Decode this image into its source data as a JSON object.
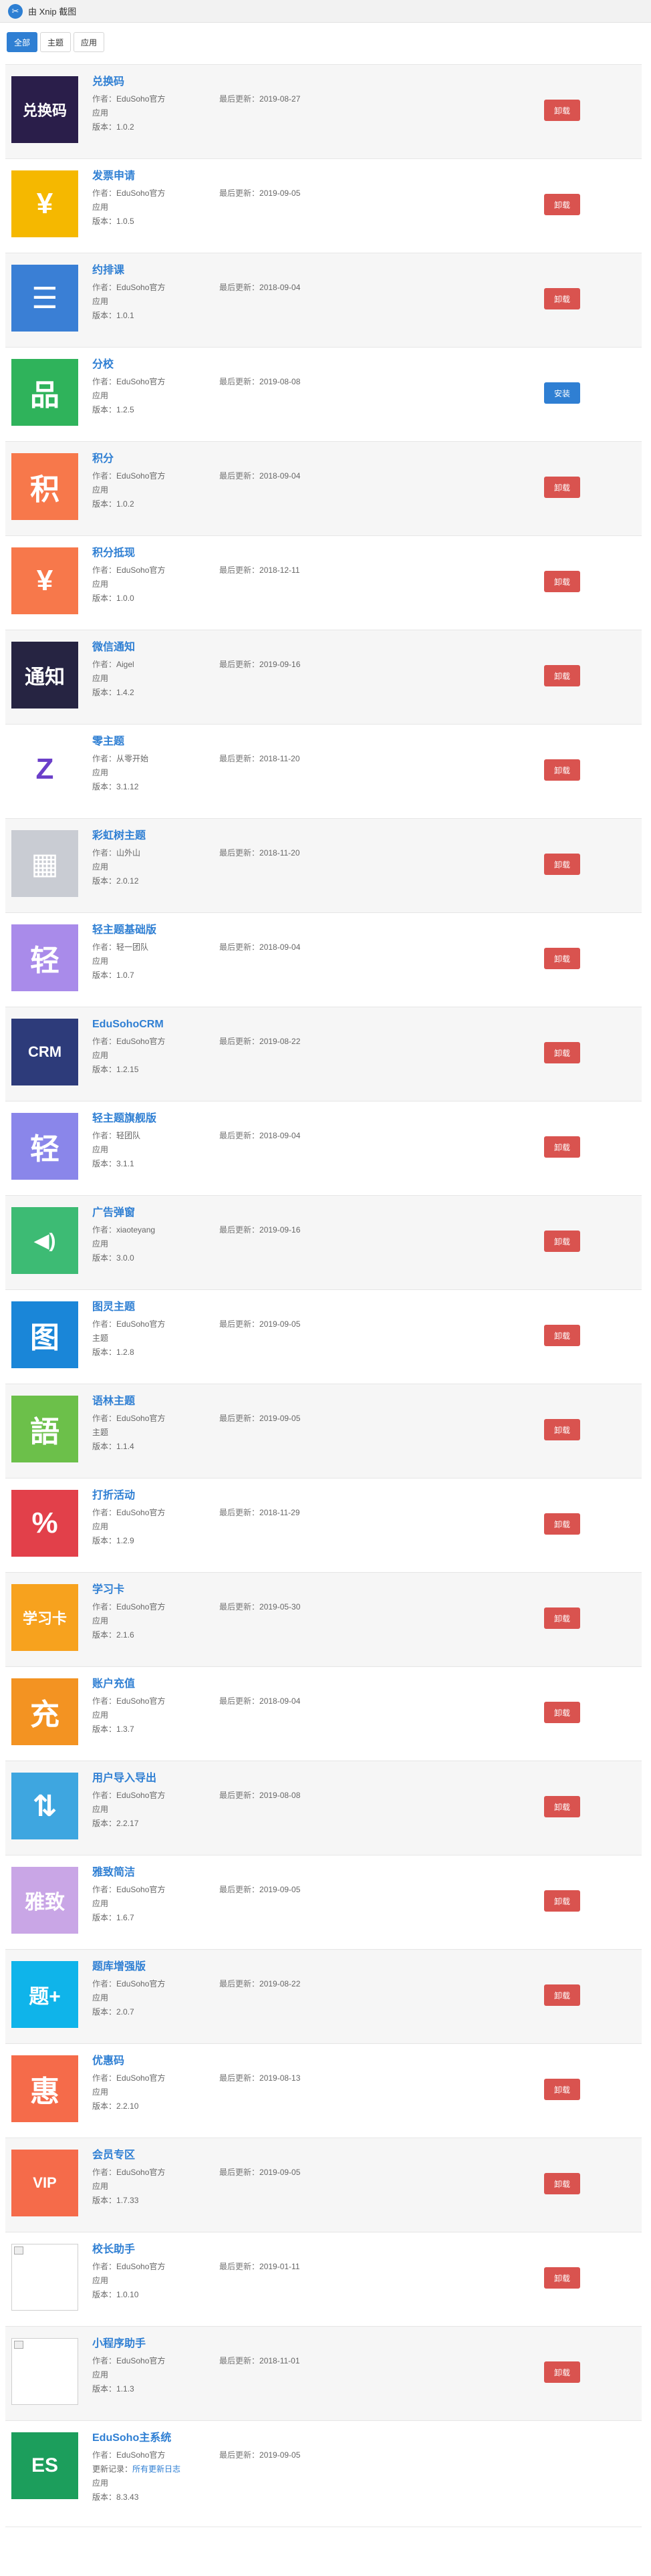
{
  "window": {
    "title": "由 Xnip 截图"
  },
  "tabs": [
    {
      "label": "全部",
      "active": true
    },
    {
      "label": "主题"
    },
    {
      "label": "应用"
    }
  ],
  "labels": {
    "author": "作者：",
    "updated": "最后更新：",
    "version": "版本：",
    "changelog": "更新记录：",
    "changelog_link": "所有更新日志"
  },
  "colors": {
    "accent": "#2f7fd3",
    "uninstall": "#d9534f",
    "install": "#2f7fd3"
  },
  "items": [
    {
      "name": "兑换码",
      "author": "EduSoho官方",
      "updated": "2019-08-27",
      "type": "应用",
      "version": "1.0.2",
      "action": "卸载",
      "icon_text": "兑换码",
      "icon_bg": "#2a1e4a",
      "icon_name": "redeem-code-icon"
    },
    {
      "name": "发票申请",
      "author": "EduSoho官方",
      "updated": "2019-09-05",
      "type": "应用",
      "version": "1.0.5",
      "action": "卸载",
      "icon_text": "¥",
      "icon_bg": "#f5b800",
      "icon_name": "invoice-icon"
    },
    {
      "name": "约排课",
      "author": "EduSoho官方",
      "updated": "2018-09-04",
      "type": "应用",
      "version": "1.0.1",
      "action": "卸载",
      "icon_text": "☰",
      "icon_bg": "#3a7fd5",
      "icon_name": "schedule-icon"
    },
    {
      "name": "分校",
      "author": "EduSoho官方",
      "updated": "2019-08-08",
      "type": "应用",
      "version": "1.2.5",
      "action": "安装",
      "icon_text": "品",
      "icon_bg": "#2fb35b",
      "icon_name": "branch-school-icon"
    },
    {
      "name": "积分",
      "author": "EduSoho官方",
      "updated": "2018-09-04",
      "type": "应用",
      "version": "1.0.2",
      "action": "卸载",
      "icon_text": "积",
      "icon_bg": "#f7784b",
      "icon_name": "points-icon"
    },
    {
      "name": "积分抵现",
      "author": "EduSoho官方",
      "updated": "2018-12-11",
      "type": "应用",
      "version": "1.0.0",
      "action": "卸载",
      "icon_text": "¥",
      "icon_bg": "#f7784b",
      "icon_name": "points-cash-icon"
    },
    {
      "name": "微信通知",
      "author": "Aigel",
      "updated": "2019-09-16",
      "type": "应用",
      "version": "1.4.2",
      "action": "卸载",
      "icon_text": "通知",
      "icon_bg": "#262442",
      "icon_name": "wechat-notify-icon"
    },
    {
      "name": "零主题",
      "author": "从零开始",
      "updated": "2018-11-20",
      "type": "应用",
      "version": "3.1.12",
      "action": "卸载",
      "icon_text": "Z",
      "icon_bg": "#ffffff",
      "icon_name": "zero-theme-icon"
    },
    {
      "name": "彩虹树主题",
      "author": "山外山",
      "updated": "2018-11-20",
      "type": "应用",
      "version": "2.0.12",
      "action": "卸载",
      "icon_text": "▦",
      "icon_bg": "#c9ccd3",
      "icon_name": "rainbow-tree-theme-icon"
    },
    {
      "name": "轻主题基础版",
      "author": "轻一团队",
      "updated": "2018-09-04",
      "type": "应用",
      "version": "1.0.7",
      "action": "卸载",
      "icon_text": "轻",
      "icon_bg": "#a98bea",
      "icon_name": "light-theme-basic-icon"
    },
    {
      "name": "EduSohoCRM",
      "author": "EduSoho官方",
      "updated": "2019-08-22",
      "type": "应用",
      "version": "1.2.15",
      "action": "卸载",
      "icon_text": "CRM",
      "icon_bg": "#2d3b7a",
      "icon_name": "crm-icon"
    },
    {
      "name": "轻主题旗舰版",
      "author": "轻团队",
      "updated": "2018-09-04",
      "type": "应用",
      "version": "3.1.1",
      "action": "卸载",
      "icon_text": "轻",
      "icon_bg": "#8a86ea",
      "icon_name": "light-theme-flagship-icon"
    },
    {
      "name": "广告弹窗",
      "author": "xiaoteyang",
      "updated": "2019-09-16",
      "type": "应用",
      "version": "3.0.0",
      "action": "卸载",
      "icon_text": "◀)",
      "icon_bg": "#3dbb74",
      "icon_name": "ad-popup-icon"
    },
    {
      "name": "图灵主题",
      "author": "EduSoho官方",
      "updated": "2019-09-05",
      "type": "主题",
      "version": "1.2.8",
      "action": "卸载",
      "icon_text": "图",
      "icon_bg": "#1a86d8",
      "icon_name": "turing-theme-icon"
    },
    {
      "name": "语林主题",
      "author": "EduSoho官方",
      "updated": "2019-09-05",
      "type": "主题",
      "version": "1.1.4",
      "action": "卸载",
      "icon_text": "語",
      "icon_bg": "#6cc04a",
      "icon_name": "yulin-theme-icon"
    },
    {
      "name": "打折活动",
      "author": "EduSoho官方",
      "updated": "2018-11-29",
      "type": "应用",
      "version": "1.2.9",
      "action": "卸载",
      "icon_text": "%",
      "icon_bg": "#e2404a",
      "icon_name": "discount-icon"
    },
    {
      "name": "学习卡",
      "author": "EduSoho官方",
      "updated": "2019-05-30",
      "type": "应用",
      "version": "2.1.6",
      "action": "卸载",
      "icon_text": "学习卡",
      "icon_bg": "#f7a21e",
      "icon_name": "study-card-icon"
    },
    {
      "name": "账户充值",
      "author": "EduSoho官方",
      "updated": "2018-09-04",
      "type": "应用",
      "version": "1.3.7",
      "action": "卸载",
      "icon_text": "充",
      "icon_bg": "#f39322",
      "icon_name": "recharge-icon"
    },
    {
      "name": "用户导入导出",
      "author": "EduSoho官方",
      "updated": "2019-08-08",
      "type": "应用",
      "version": "2.2.17",
      "action": "卸载",
      "icon_text": "⇅",
      "icon_bg": "#3ea6e0",
      "icon_name": "user-import-export-icon"
    },
    {
      "name": "雅致简洁",
      "author": "EduSoho官方",
      "updated": "2019-09-05",
      "type": "应用",
      "version": "1.6.7",
      "action": "卸载",
      "icon_text": "雅致",
      "icon_bg": "#c9a6e6",
      "icon_name": "elegant-theme-icon"
    },
    {
      "name": "题库增强版",
      "author": "EduSoho官方",
      "updated": "2019-08-22",
      "type": "应用",
      "version": "2.0.7",
      "action": "卸载",
      "icon_text": "题+",
      "icon_bg": "#0fb4ea",
      "icon_name": "question-bank-plus-icon"
    },
    {
      "name": "优惠码",
      "author": "EduSoho官方",
      "updated": "2019-08-13",
      "type": "应用",
      "version": "2.2.10",
      "action": "卸载",
      "icon_text": "惠",
      "icon_bg": "#f56b4a",
      "icon_name": "coupon-icon"
    },
    {
      "name": "会员专区",
      "author": "EduSoho官方",
      "updated": "2019-09-05",
      "type": "应用",
      "version": "1.7.33",
      "action": "卸载",
      "icon_text": "VIP",
      "icon_bg": "#f56b4a",
      "icon_name": "vip-icon"
    },
    {
      "name": "校长助手",
      "author": "EduSoho官方",
      "updated": "2019-01-11",
      "type": "应用",
      "version": "1.0.10",
      "action": "卸载",
      "icon_text": "",
      "icon_bg": "#ffffff",
      "icon_name": "broken-image-icon",
      "broken": true
    },
    {
      "name": "小程序助手",
      "author": "EduSoho官方",
      "updated": "2018-11-01",
      "type": "应用",
      "version": "1.1.3",
      "action": "卸载",
      "icon_text": "",
      "icon_bg": "#ffffff",
      "icon_name": "broken-image-icon",
      "broken": true
    },
    {
      "name": "EduSoho主系统",
      "author": "EduSoho官方",
      "updated": "2019-09-05",
      "type": "应用",
      "version": "8.3.43",
      "action": "",
      "icon_text": "ES",
      "icon_bg": "#1c9e5c",
      "icon_name": "edusoho-main-icon",
      "changelog": true
    }
  ]
}
